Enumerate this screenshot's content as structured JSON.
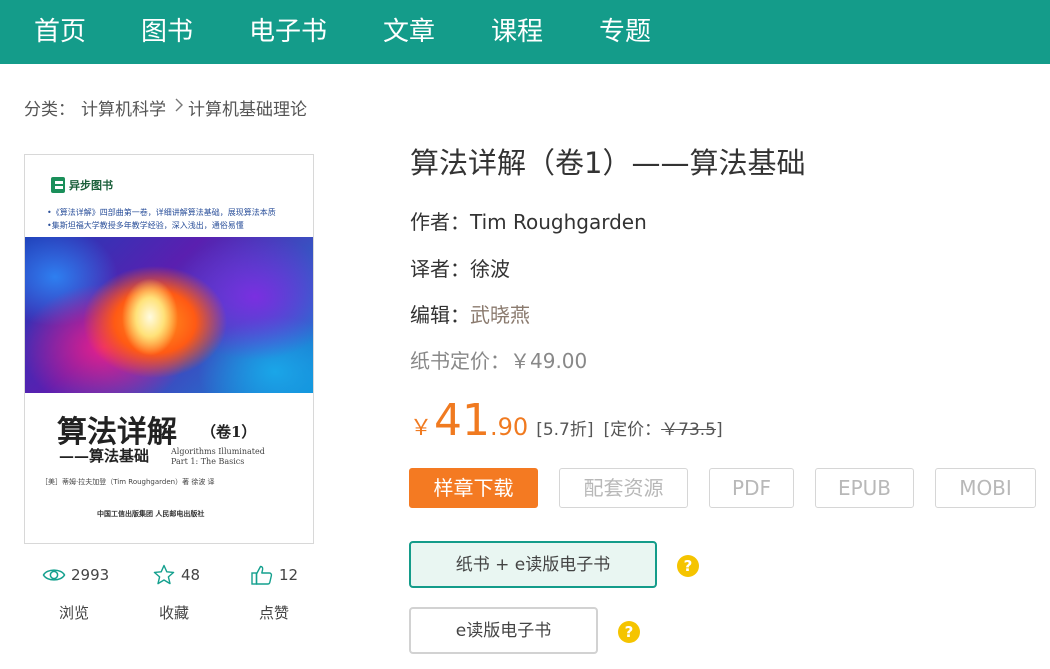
{
  "nav": {
    "items": [
      {
        "label": "首页"
      },
      {
        "label": "图书"
      },
      {
        "label": "电子书"
      },
      {
        "label": "文章"
      },
      {
        "label": "课程"
      },
      {
        "label": "专题"
      }
    ]
  },
  "breadcrumb": {
    "prefix": "分类：",
    "level1": "计算机科学",
    "level2": "计算机基础理论"
  },
  "cover": {
    "publisher_logo": "异步图书",
    "bullet1": "•《算法详解》四部曲第一卷，详细讲解算法基础，展现算法本质",
    "bullet2": "•集斯坦福大学教授多年教学经验，深入浅出，通俗易懂",
    "title": "算法详解",
    "volume": "（卷1）",
    "subtitle": "——算法基础",
    "en_title_1": "Algorithms Illuminated",
    "en_title_2": "Part 1: The Basics",
    "author_line": "［美］蒂姆·拉夫加登（Tim Roughgarden）著        徐波 译",
    "publisher_line": "中国工信出版集团    人民邮电出版社"
  },
  "stats": {
    "views": {
      "count": "2993",
      "label": "浏览",
      "icon": "eye-icon"
    },
    "favorites": {
      "count": "48",
      "label": "收藏",
      "icon": "star-icon"
    },
    "likes": {
      "count": "12",
      "label": "点赞",
      "icon": "thumbs-up-icon"
    }
  },
  "book": {
    "title": "算法详解（卷1）——算法基础",
    "author_label": "作者：",
    "author": "Tim Roughgarden",
    "translator_label": "译者：",
    "translator": "徐波",
    "editor_label": "编辑：",
    "editor": "武晓燕",
    "paper_price_label": "纸书定价：",
    "paper_price": "￥49.00"
  },
  "price": {
    "currency": "￥",
    "integer": "41",
    "decimal": ".90",
    "discount": "[5.7折]",
    "list_label": "[定价：",
    "list_value": "￥73.5",
    "list_close": "]"
  },
  "buttons": {
    "sample": "样章下载",
    "resources": "配套资源",
    "pdf": "PDF",
    "epub": "EPUB",
    "mobi": "MOBI"
  },
  "options": {
    "bundle": "纸书 + e读版电子书",
    "ebook": "e读版电子书",
    "help": "?"
  },
  "colors": {
    "nav_bg": "#149c8a",
    "accent_orange": "#f47a22",
    "price_orange": "#f07a20",
    "help_yellow": "#f5c400"
  }
}
